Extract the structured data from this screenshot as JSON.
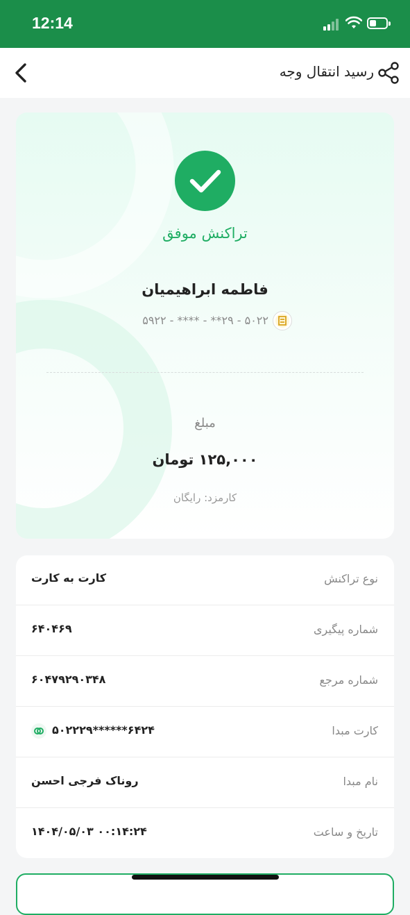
{
  "status_bar": {
    "time": "12:14"
  },
  "header": {
    "title": "رسید انتقال وجه"
  },
  "receipt": {
    "status": "تراکنش موفق",
    "recipient_name": "فاطمه ابراهیمیان",
    "card_number": "۵۹۲۲ - **** - **۲۹ - ۵۰۲۲",
    "amount_label": "مبلغ",
    "amount": "۱۲۵,۰۰۰ تومان",
    "fee": "کارمزد: رایگان"
  },
  "details": [
    {
      "label": "نوع تراکنش",
      "value": "کارت به کارت"
    },
    {
      "label": "شماره پیگیری",
      "value": "۶۴۰۴۶۹"
    },
    {
      "label": "شماره مرجع",
      "value": "۶۰۴۷۹۲۹۰۳۴۸"
    },
    {
      "label": "کارت مبدا",
      "value": "۵۰۲۲۲۹******۶۴۲۴"
    },
    {
      "label": "نام مبدا",
      "value": "روناک فرجی احسن"
    },
    {
      "label": "تاریخ و ساعت",
      "value": "۱۴۰۴/۰۵/۰۳ ۰۰:۱۴:۲۴"
    }
  ],
  "colors": {
    "brand": "#1b8e4a",
    "success": "#1fad63"
  }
}
